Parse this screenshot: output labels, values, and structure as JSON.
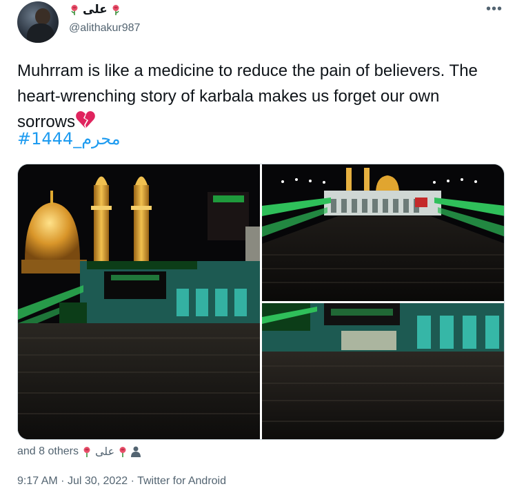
{
  "author": {
    "display_name": "علی",
    "handle": "@alithakur987"
  },
  "more_label": "•••",
  "tweet": {
    "text": "Muhrram is like a medicine to reduce the pain of believers. The heart-wrenching story of karbala makes us forget our own sorrows",
    "hashtag": "#محرم_1444"
  },
  "likers": {
    "prefix": "and 8 others",
    "name": "علی"
  },
  "meta": {
    "time": "9:17 AM",
    "separator": "·",
    "date": "Jul 30, 2022",
    "source": "Twitter for Android"
  },
  "icons": {
    "rose": "rose-icon",
    "broken_heart": "broken-heart-icon",
    "person": "person-icon",
    "more": "more-dots-icon"
  },
  "colors": {
    "link": "#1d9bf0",
    "secondary_text": "#536471",
    "heart": "#e0245e",
    "gold": "#d9a12b",
    "green_light": "#2fbf5a"
  }
}
